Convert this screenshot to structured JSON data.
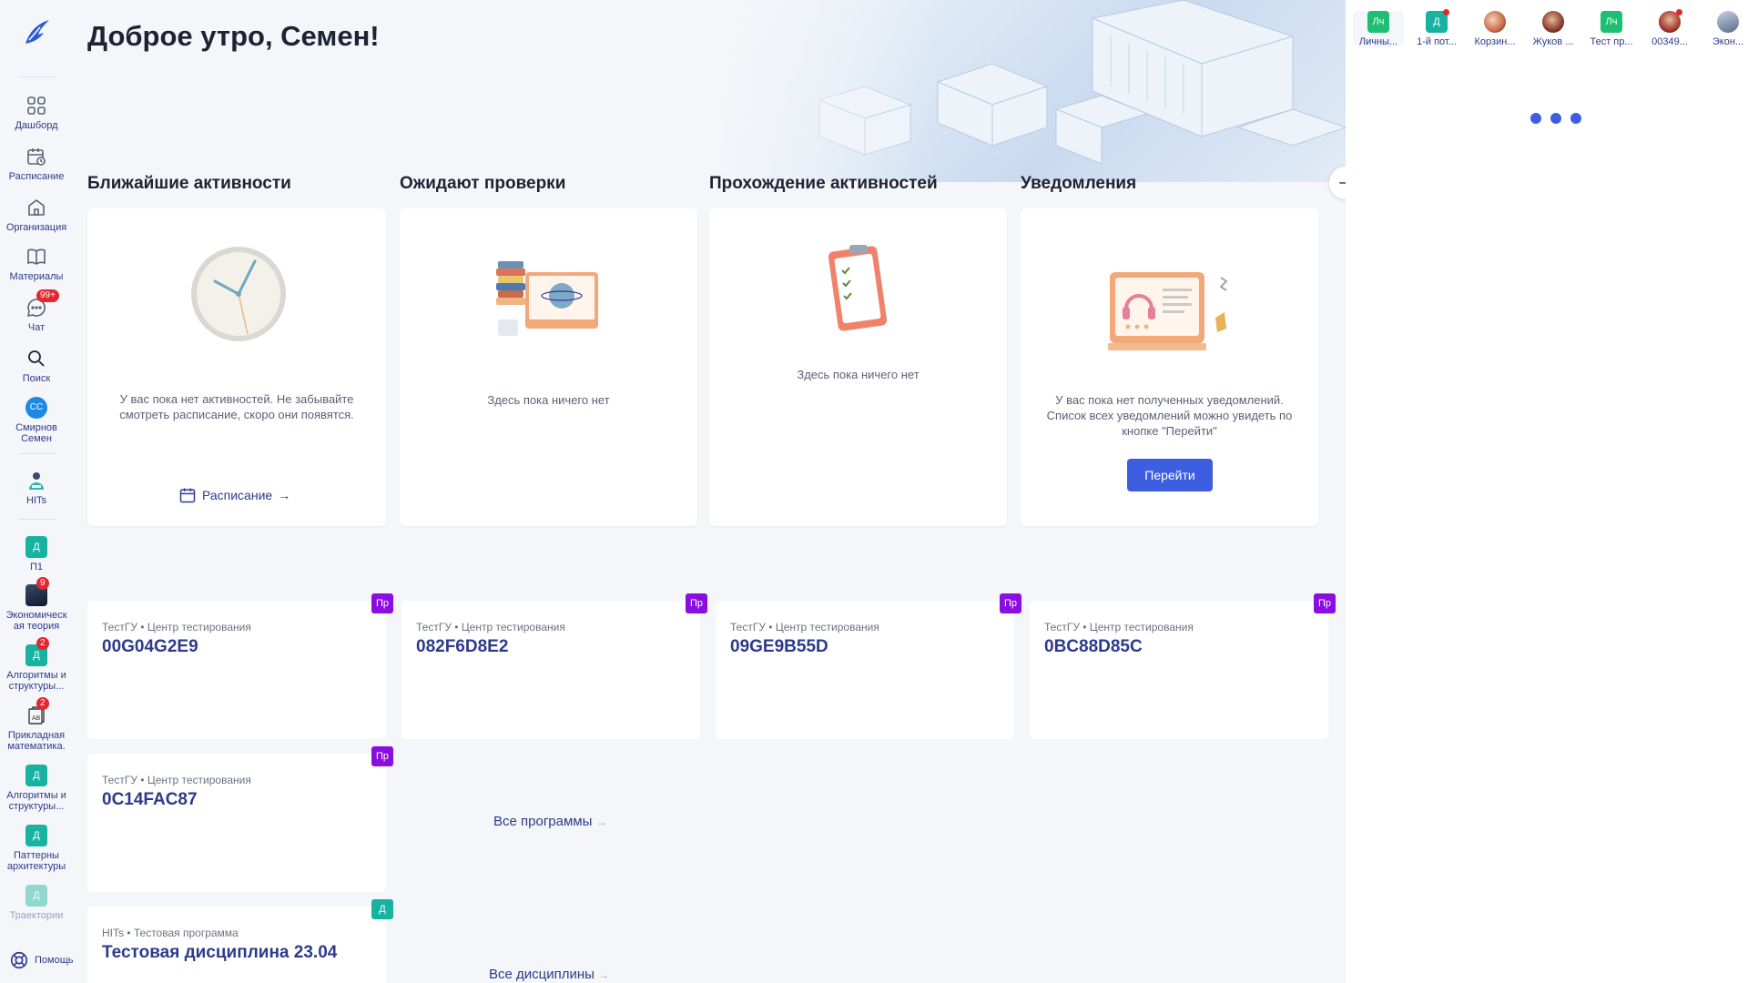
{
  "sidebar": {
    "nav": [
      {
        "label": "Дашборд",
        "icon": "dashboard-icon"
      },
      {
        "label": "Расписание",
        "icon": "schedule-icon"
      },
      {
        "label": "Организация",
        "icon": "organization-icon"
      },
      {
        "label": "Материалы",
        "icon": "materials-icon"
      },
      {
        "label": "Чат",
        "icon": "chat-icon",
        "badge": "99+"
      },
      {
        "label": "Поиск",
        "icon": "search-icon"
      }
    ],
    "profile": {
      "initials": "СС",
      "name_line1": "Смирнов",
      "name_line2": "Семен"
    },
    "org": {
      "label": "HITs"
    },
    "courses": [
      {
        "tile": "Д",
        "label_line1": "П1",
        "label_line2": ""
      },
      {
        "tile": "",
        "label_line1": "Экономическ",
        "label_line2": "ая теория",
        "badge": "9"
      },
      {
        "tile": "Д",
        "label_line1": "Алгоритмы и",
        "label_line2": "структуры...",
        "badge": "2"
      },
      {
        "tile": "",
        "label_line1": "Прикладная",
        "label_line2": "математика.",
        "badge": "2"
      },
      {
        "tile": "Д",
        "label_line1": "Алгоритмы и",
        "label_line2": "структуры..."
      },
      {
        "tile": "Д",
        "label_line1": "Паттерны",
        "label_line2": "архитектуры"
      },
      {
        "tile": "Д",
        "label_line1": "Траектории",
        "label_line2": ""
      }
    ],
    "help_label": "Помощь"
  },
  "main": {
    "greeting": "Доброе утро, Семен!",
    "sections": {
      "upcoming": {
        "title": "Ближайшие активности",
        "empty_text": "У вас пока нет активностей. Не забывайте смотреть расписание, скоро они появятся.",
        "link": "Расписание"
      },
      "review": {
        "title": "Ожидают проверки",
        "empty_text": "Здесь пока ничего нет"
      },
      "progress": {
        "title": "Прохождение активностей",
        "empty_text": "Здесь пока ничего нет"
      },
      "notifications": {
        "title": "Уведомления",
        "empty_text": "У вас пока нет полученных уведомлений. Список всех уведомлений можно увидеть по кнопке \"Перейти\"",
        "button": "Перейти"
      }
    },
    "programs": [
      {
        "org": "ТестГУ • Центр тестирования",
        "code": "00G04G2E9",
        "tag": "Пр"
      },
      {
        "org": "ТестГУ • Центр тестирования",
        "code": "082F6D8E2",
        "tag": "Пр"
      },
      {
        "org": "ТестГУ • Центр тестирования",
        "code": "09GE9B55D",
        "tag": "Пр"
      },
      {
        "org": "ТестГУ • Центр тестирования",
        "code": "0BC88D85C",
        "tag": "Пр"
      },
      {
        "org": "ТестГУ • Центр тестирования",
        "code": "0C14FAC87",
        "tag": "Пр"
      }
    ],
    "all_programs": "Все программы",
    "discipline": {
      "org": "HITs • Тестовая программа",
      "name": "Тестовая дисциплина 23.04",
      "tag": "Д"
    },
    "all_disciplines": "Все дисциплины"
  },
  "chats": [
    {
      "label": "Личны...",
      "tile": "Лч",
      "color": "#1cbf73"
    },
    {
      "label": "1-й пот...",
      "tile": "Д",
      "color": "#17b3a0",
      "dot": true
    },
    {
      "label": "Корзин...",
      "tile": "",
      "color": "#c96a4a"
    },
    {
      "label": "Жуков ...",
      "tile": "",
      "color": "#8a3b2b"
    },
    {
      "label": "Тест пр...",
      "tile": "Лч",
      "color": "#1cbf73"
    },
    {
      "label": "00349...",
      "tile": "",
      "color": "#a63d33",
      "dot": true
    },
    {
      "label": "Экон...",
      "tile": "",
      "color": "#5a6a8a"
    }
  ],
  "colors": {
    "accent": "#3d5ee1",
    "link": "#2d3a8c",
    "teal": "#17b3a0",
    "purple": "#8a0ee0",
    "badge_red": "#e5262f"
  }
}
